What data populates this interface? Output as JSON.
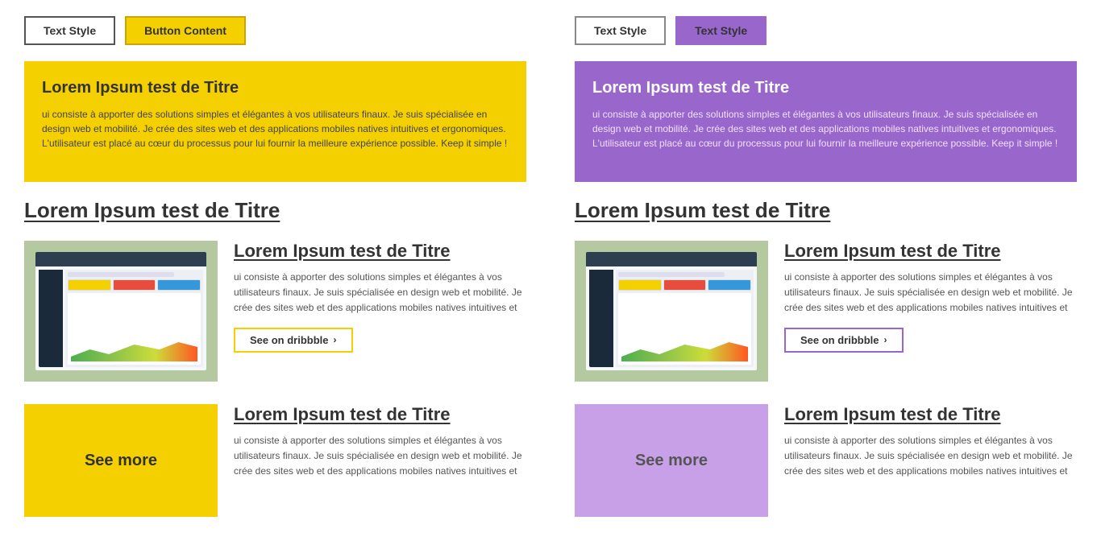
{
  "left": {
    "buttons": [
      {
        "label": "Text Style",
        "type": "outline"
      },
      {
        "label": "Button Content",
        "type": "yellow"
      }
    ],
    "hero_card": {
      "title": "Lorem Ipsum test de Titre",
      "body": "ui consiste à apporter des solutions simples et élégantes à vos utilisateurs finaux. Je suis spécialisée en design web et mobilité. Je crée des sites web et des applications mobiles natives intuitives et ergonomiques. L'utilisateur est placé au cœur du processus pour lui fournir la meilleure expérience possible. Keep it simple !"
    },
    "section_title": "Lorem Ipsum test de Titre",
    "project_card": {
      "title": "Lorem Ipsum test de Titre",
      "body": "ui consiste à apporter des solutions simples et élégantes à vos utilisateurs finaux. Je suis spécialisée en design web et mobilité. Je crée des sites web et des applications mobiles natives intuitives et",
      "btn_label": "See on dribbble",
      "btn_chevron": "›"
    },
    "see_more": {
      "thumb_label": "See more",
      "card_title": "Lorem Ipsum test de Titre",
      "card_body": "ui consiste à apporter des solutions simples et élégantes à vos utilisateurs finaux. Je suis spécialisée en design web et mobilité. Je crée des sites web et des applications mobiles natives intuitives et"
    }
  },
  "right": {
    "buttons": [
      {
        "label": "Text Style",
        "type": "outline"
      },
      {
        "label": "Text Style",
        "type": "purple"
      }
    ],
    "hero_card": {
      "title": "Lorem Ipsum test de Titre",
      "body": "ui consiste à apporter des solutions simples et élégantes à vos utilisateurs finaux. Je suis spécialisée en design web et mobilité. Je crée des sites web et des applications mobiles natives intuitives et ergonomiques. L'utilisateur est placé au cœur du processus pour lui fournir la meilleure expérience possible. Keep it simple !"
    },
    "section_title": "Lorem Ipsum test de Titre",
    "project_card": {
      "title": "Lorem Ipsum test de Titre",
      "body": "ui consiste à apporter des solutions simples et élégantes à vos utilisateurs finaux. Je suis spécialisée en design web et mobilité. Je crée des sites web et des applications mobiles natives intuitives et",
      "btn_label": "See on dribbble",
      "btn_chevron": "›"
    },
    "see_more": {
      "thumb_label": "See more",
      "card_title": "Lorem Ipsum test de Titre",
      "card_body": "ui consiste à apporter des solutions simples et élégantes à vos utilisateurs finaux. Je suis spécialisée en design web et mobilité. Je crée des sites web et des applications mobiles natives intuitives et"
    }
  }
}
